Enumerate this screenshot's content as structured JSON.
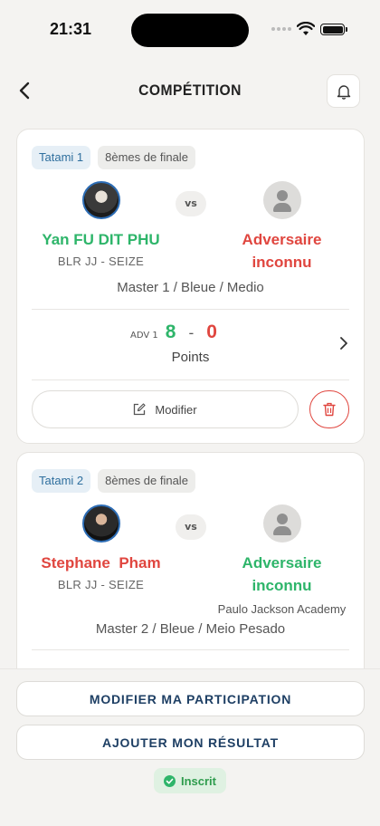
{
  "status_bar": {
    "time": "21:31"
  },
  "header": {
    "title": "COMPÉTITION"
  },
  "matches": [
    {
      "tatami": "Tatami 1",
      "round": "8èmes de finale",
      "vs": "vs",
      "left": {
        "name": "Yan FU DIT PHU",
        "club": "BLR JJ - SEIZE"
      },
      "right": {
        "name": "Adversaire inconnu"
      },
      "category": "Master 1 / Bleue / Medio",
      "score": {
        "tag": "ADV 1",
        "left": "8",
        "sep": "-",
        "right": "0",
        "label": "Points"
      },
      "modify_label": "Modifier"
    },
    {
      "tatami": "Tatami 2",
      "round": "8èmes de finale",
      "vs": "vs",
      "left": {
        "name": "Stephane  Pham",
        "club": "BLR JJ - SEIZE"
      },
      "right": {
        "name": "Adversaire inconnu",
        "club": "Paulo Jackson Academy"
      },
      "category": "Master 2 / Bleue / Meio Pesado"
    }
  ],
  "actions": {
    "modify_participation": "MODIFIER MA PARTICIPATION",
    "add_result": "AJOUTER MON RÉSULTAT",
    "status": "Inscrit"
  },
  "colors": {
    "winner": "#2eb56a",
    "loser": "#e0463f",
    "brand": "#1e3f64"
  }
}
